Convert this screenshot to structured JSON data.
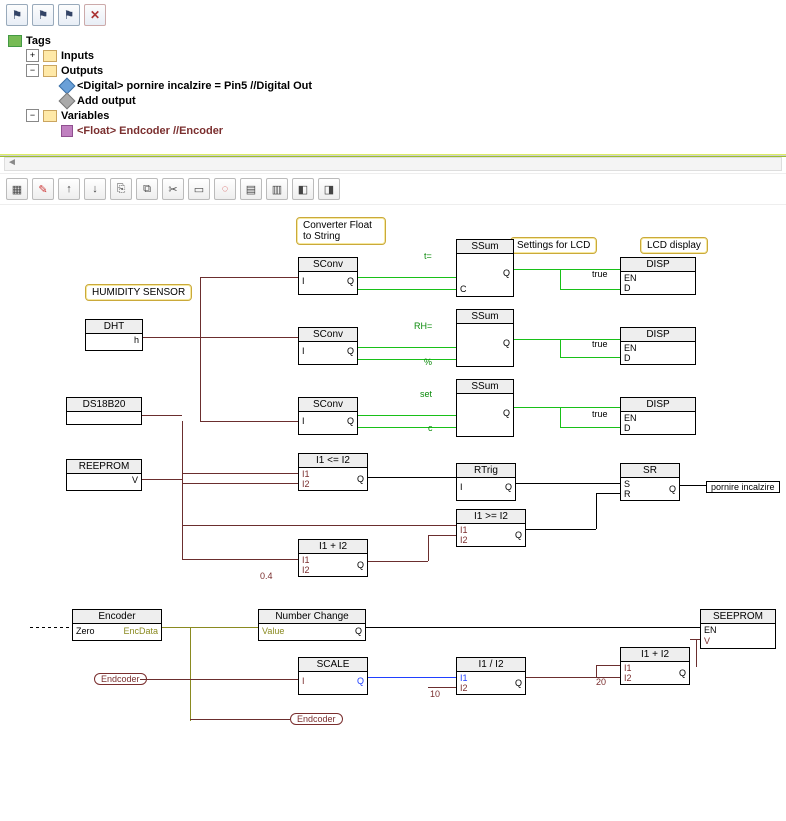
{
  "toolbar1": {
    "close": "✕"
  },
  "tree": {
    "tags": "Tags",
    "inputs": "Inputs",
    "outputs": "Outputs",
    "output_digital": "<Digital> pornire incalzire = Pin5  //Digital Out",
    "add_output": "Add output",
    "variables": "Variables",
    "var_float": "<Float> Endcoder  //Encoder"
  },
  "notes": {
    "humidity": "HUMIDITY SENSOR",
    "conv": "Converter Float to String",
    "settings": "Settings for LCD",
    "lcd": "LCD display"
  },
  "blocks": {
    "dht": "DHT",
    "dht_port": "h",
    "ds18": "DS18B20",
    "reeprom": "REEPROM",
    "reeprom_port": "V",
    "sconv": "SConv",
    "I": "I",
    "Q": "Q",
    "C": "C",
    "ssum": "SSum",
    "disp": "DISP",
    "en": "EN",
    "D": "D",
    "cmp_le": "I1 <= I2",
    "I1": "I1",
    "I2": "I2",
    "rtrig": "RTrig",
    "sr": "SR",
    "S": "S",
    "R": "R",
    "cmp_ge": "I1 >= I2",
    "add": "I1 + I2",
    "encoder": "Encoder",
    "zero": "Zero",
    "encdata": "EncData",
    "numchange": "Number Change",
    "value": "Value",
    "scale": "SCALE",
    "div": "I1 / I2",
    "seeprom": "SEEPROM",
    "V": "V"
  },
  "labels": {
    "t_eq": "t=",
    "rh_eq": "RH=",
    "pct": "%",
    "set": "set",
    "c": "c",
    "true": "true",
    "val04": "0.4",
    "val10": "10",
    "val20": "20",
    "pornire": "pornire incalzire",
    "endcoder": "Endcoder"
  }
}
